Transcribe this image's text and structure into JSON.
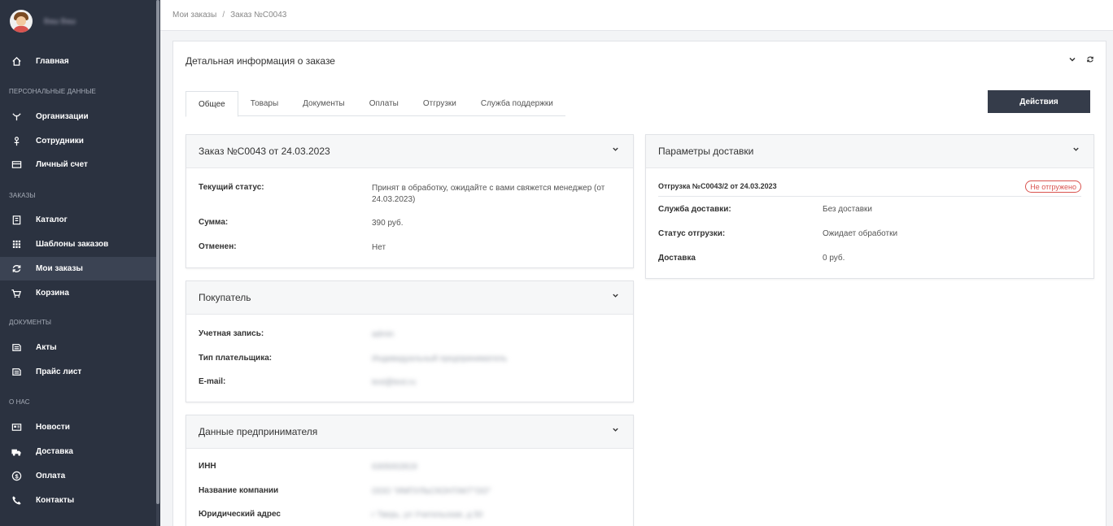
{
  "sidebar": {
    "user_name": "Ваш Ваш",
    "items": [
      {
        "label": "Главная",
        "icon": "home-icon"
      },
      {
        "label": "Организации",
        "icon": "organization-icon"
      },
      {
        "label": "Сотрудники",
        "icon": "user-icon"
      },
      {
        "label": "Личный счет",
        "icon": "credit-card-icon"
      },
      {
        "label": "Каталог",
        "icon": "catalog-icon"
      },
      {
        "label": "Шаблоны заказов",
        "icon": "grid-icon"
      },
      {
        "label": "Мои заказы",
        "icon": "refresh-icon"
      },
      {
        "label": "Корзина",
        "icon": "cart-icon"
      },
      {
        "label": "Акты",
        "icon": "document-icon"
      },
      {
        "label": "Прайс лист",
        "icon": "document-icon"
      },
      {
        "label": "Новости",
        "icon": "news-icon"
      },
      {
        "label": "Доставка",
        "icon": "truck-icon"
      },
      {
        "label": "Оплата",
        "icon": "dollar-icon"
      },
      {
        "label": "Контакты",
        "icon": "phone-icon"
      }
    ],
    "sections": {
      "personal": "ПЕРСОНАЛЬНЫЕ ДАННЫЕ",
      "orders": "ЗАКАЗЫ",
      "documents": "ДОКУМЕНТЫ",
      "about": "О НАС"
    }
  },
  "breadcrumb": {
    "parent": "Мои заказы",
    "separator": "/",
    "current": "Заказ №С0043"
  },
  "card": {
    "title": "Детальная информация о заказе",
    "tabs": [
      "Общее",
      "Товары",
      "Документы",
      "Оплаты",
      "Отгрузки",
      "Служба поддержки"
    ],
    "actions_label": "Действия"
  },
  "order_panel": {
    "title": "Заказ №С0043 от 24.03.2023",
    "rows": [
      {
        "key": "Текущий статус:",
        "value": "Принят в обработку, ожидайте с вами свяжется менеджер (от 24.03.2023)"
      },
      {
        "key": "Сумма:",
        "value": "390 руб."
      },
      {
        "key": "Отменен:",
        "value": "Нет"
      }
    ]
  },
  "buyer_panel": {
    "title": "Покупатель",
    "rows": [
      {
        "key": "Учетная запись:",
        "value": "admin"
      },
      {
        "key": "Тип плательщика:",
        "value": "Индивидуальный предприниматель"
      },
      {
        "key": "E-mail:",
        "value": "test@test.ru"
      }
    ]
  },
  "entrepreneur_panel": {
    "title": "Данные предпринимателя",
    "rows": [
      {
        "key": "ИНН",
        "value": "6305002819"
      },
      {
        "key": "Название компании",
        "value": "ООО \"ИМПУЛЬСКОНТАКТ\"ОО\""
      },
      {
        "key": "Юридический адрес",
        "value": "г Тверь, ул Учительская, д 50"
      }
    ]
  },
  "delivery_panel": {
    "title": "Параметры доставки",
    "shipment_title": "Отгрузка №С0043/2 от 24.03.2023",
    "shipment_badge": "Не отгружено",
    "rows": [
      {
        "key": "Служба доставки:",
        "value": "Без доставки"
      },
      {
        "key": "Статус отгрузки:",
        "value": "Ожидает обработки"
      },
      {
        "key": "Доставка",
        "value": "0 руб."
      }
    ]
  },
  "colors": {
    "sidebar_bg": "#2b3240",
    "sidebar_active": "#3b4353",
    "button_bg": "#353c4a",
    "badge_red": "#d9534f"
  }
}
